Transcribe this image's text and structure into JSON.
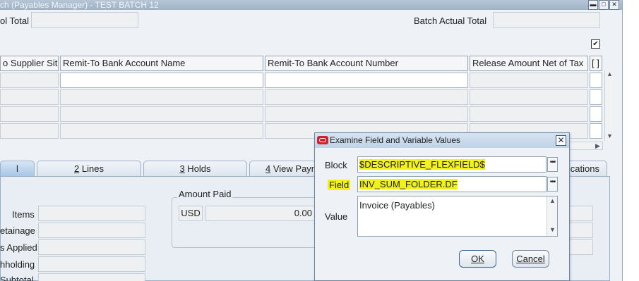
{
  "window": {
    "title": "ch (Payables Manager) - TEST BATCH 12",
    "minimize_icon": "minimize-icon",
    "maximize_icon": "maximize-icon",
    "close_icon": "close-icon"
  },
  "header": {
    "control_total_label": "ol Total",
    "control_total_value": "",
    "batch_actual_total_label": "Batch Actual Total",
    "batch_actual_total_value": "",
    "checkbox_checked": true
  },
  "grid": {
    "columns": [
      "o Supplier Site",
      "Remit-To Bank Account Name",
      "Remit-To Bank Account Number",
      "Release Amount Net of Tax",
      "[ ]"
    ],
    "row_count": 4
  },
  "tabs": [
    {
      "label": "l",
      "active": true
    },
    {
      "num": "2",
      "label": " Lines"
    },
    {
      "num": "3",
      "label": " Holds"
    },
    {
      "num": "4",
      "label": " View Payn"
    },
    {
      "label": "cations"
    }
  ],
  "summary": {
    "labels": [
      "Items",
      "etainage",
      "s Applied",
      "hholding",
      "Subtotal"
    ],
    "amount_paid_label": "Amount Paid",
    "currency": "USD",
    "amount_paid_value": "0.00"
  },
  "dialog": {
    "title": "Examine Field and Variable Values",
    "block_label": "Block",
    "block_value": "$DESCRIPTIVE_FLEXFIELD$",
    "field_label": "Field",
    "field_value": "INV_SUM_FOLDER.DF",
    "value_label": "Value",
    "value_text": "Invoice (Payables)",
    "ok_label": "OK",
    "cancel_label": "Cancel",
    "highlight_color": "#f2f21a"
  }
}
